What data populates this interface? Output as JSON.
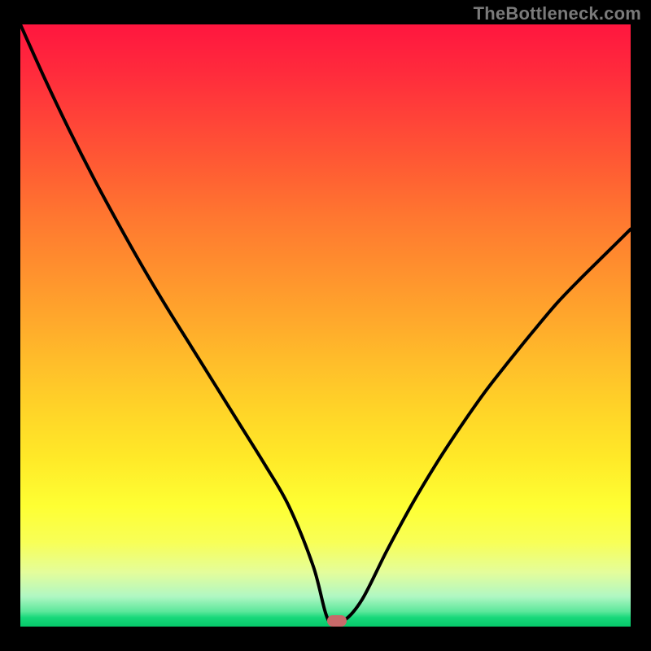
{
  "watermark": "TheBottleneck.com",
  "chart_data": {
    "type": "line",
    "title": "",
    "xlabel": "",
    "ylabel": "",
    "x": [
      0.0,
      0.04,
      0.08,
      0.12,
      0.16,
      0.2,
      0.24,
      0.28,
      0.32,
      0.36,
      0.4,
      0.44,
      0.48,
      0.505,
      0.53,
      0.56,
      0.6,
      0.64,
      0.68,
      0.72,
      0.76,
      0.8,
      0.84,
      0.88,
      0.92,
      0.96,
      1.0
    ],
    "y": [
      1.0,
      0.91,
      0.825,
      0.745,
      0.67,
      0.598,
      0.53,
      0.465,
      0.4,
      0.335,
      0.27,
      0.2,
      0.1,
      0.01,
      0.01,
      0.045,
      0.125,
      0.2,
      0.268,
      0.33,
      0.388,
      0.44,
      0.49,
      0.538,
      0.58,
      0.62,
      0.66
    ],
    "xlim": [
      0,
      1
    ],
    "ylim": [
      0,
      1
    ],
    "marker": {
      "x": 0.518,
      "y": 0.01
    },
    "colors": {
      "curve": "#000000",
      "marker": "#c76a6a",
      "gradient_top": "#ff163f",
      "gradient_bottom": "#06c86a"
    }
  }
}
